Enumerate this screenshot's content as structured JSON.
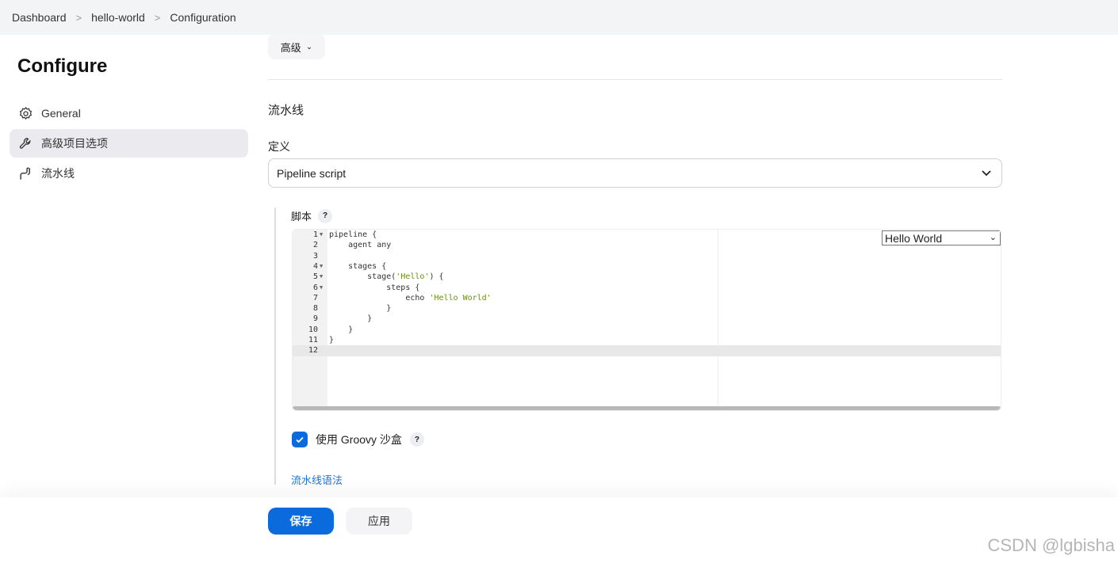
{
  "breadcrumb": [
    "Dashboard",
    "hello-world",
    "Configuration"
  ],
  "title": "Configure",
  "sidebar": {
    "items": [
      {
        "label": "General",
        "icon": "gear-icon"
      },
      {
        "label": "高级项目选项",
        "icon": "wrench-icon",
        "active": true
      },
      {
        "label": "流水线",
        "icon": "pipeline-icon"
      }
    ]
  },
  "advanced_label": "高级",
  "section_title": "流水线",
  "definition": {
    "label": "定义",
    "value": "Pipeline script"
  },
  "script": {
    "label": "脚本",
    "help": "?",
    "sample_select": "Hello World",
    "lines": [
      "pipeline {",
      "    agent any",
      "",
      "    stages {",
      "        stage('Hello') {",
      "            steps {",
      "                echo 'Hello World'",
      "            }",
      "        }",
      "    }",
      "}",
      ""
    ],
    "folds": [
      1,
      4,
      5,
      6
    ],
    "current_line": 12
  },
  "sandbox": {
    "label": "使用 Groovy 沙盒",
    "checked": true,
    "help": "?"
  },
  "syntax_link": "流水线语法",
  "buttons": {
    "save": "保存",
    "apply": "应用"
  },
  "colors": {
    "accent": "#0b6bdc",
    "string": "#6a8d1b"
  },
  "watermark": "CSDN @lgbisha"
}
